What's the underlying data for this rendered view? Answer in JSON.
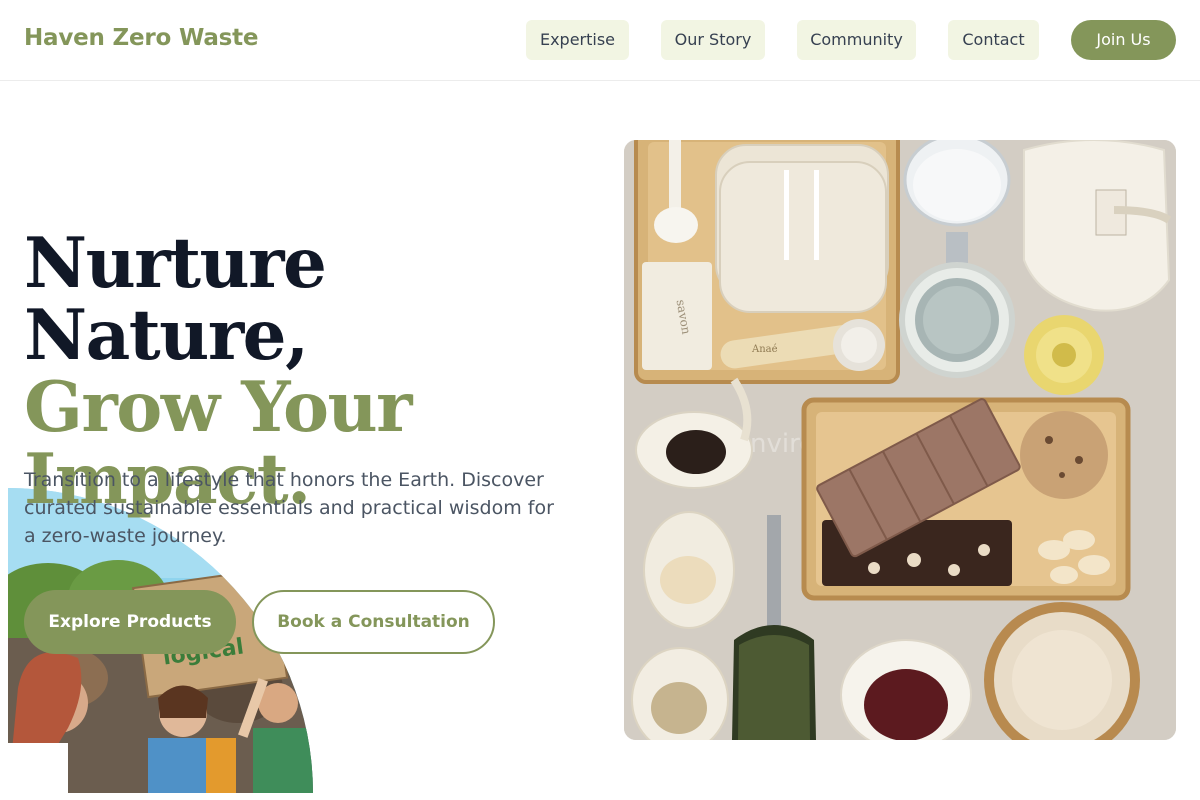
{
  "brand": {
    "name": "Haven Zero Waste"
  },
  "nav": {
    "items": [
      {
        "label": "Expertise"
      },
      {
        "label": "Our Story"
      },
      {
        "label": "Community"
      },
      {
        "label": "Contact"
      }
    ],
    "cta_label": "Join Us"
  },
  "hero": {
    "title_line1": "Nurture Nature,",
    "title_line2": "Grow Your",
    "title_line3": "Impact.",
    "subtitle": "Transition to a lifestyle that honors the Earth. Discover curated sustainable essentials and practical wisdom for a zero-waste journey.",
    "primary_button": "Explore Products",
    "secondary_button": "Book a Consultation"
  },
  "images": {
    "protest": {
      "sign_text": "Eco-logical"
    },
    "products": {
      "watermark": "environmentally",
      "brush_brand": "Anaé"
    }
  },
  "colors": {
    "accent": "#84965a",
    "nav_bg": "#f2f5e3",
    "heading": "#111827",
    "body_text": "#4b5563"
  }
}
